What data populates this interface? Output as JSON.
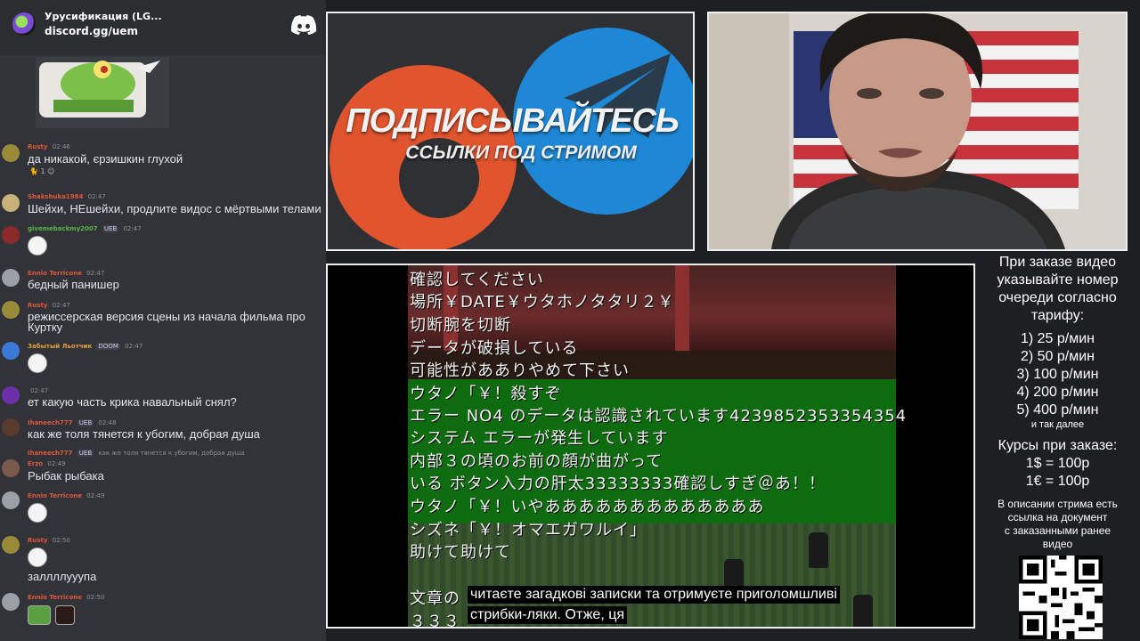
{
  "server": {
    "name": "Урусификация (LG...",
    "invite": "discord.gg/uem"
  },
  "chat": {
    "messages": [
      {
        "user": "Rusty",
        "time": "02:46",
        "text": "да никакой, єрзишкин глухой",
        "reactions": "1"
      },
      {
        "user": "Shakshuka1984",
        "time": "02:47",
        "text": "Шейхи, НЕшейхи, продлите видос с мёртвыми телами"
      },
      {
        "user": "givemebackmy2007",
        "badge": "UEB",
        "time": "02:47",
        "text": ""
      },
      {
        "user": "Ennio Terricone",
        "time": "02:47",
        "text": "бедный панишер"
      },
      {
        "user": "Rusty",
        "time": "02:47",
        "text": "режиссерская версия сцены из начала фильма про",
        "text2": "Куртку"
      },
      {
        "user": "Забытый Льотчик",
        "badge": "DOOM",
        "time": "02:47",
        "text": ""
      },
      {
        "user": "",
        "time": "02:47",
        "text": "ет какую часть крика навальный снял?"
      },
      {
        "user": "Ihaneech777",
        "badge": "UEB",
        "time": "02:48",
        "text": "как же толя тянется к убогим, добрая душа"
      },
      {
        "user": "Ihaneech777",
        "badge": "UEB",
        "time": "",
        "text": "как же толя тянется к убогим, добрая душа"
      },
      {
        "user": "Erzo",
        "time": "02:49",
        "text": "Рыбак рыбака"
      },
      {
        "user": "Ennio Terricone",
        "time": "02:49",
        "text": ""
      },
      {
        "user": "Rusty",
        "time": "02:50",
        "text": ""
      },
      {
        "user": "",
        "time": "",
        "text": "заллллууупа"
      },
      {
        "user": "Ennio Terricone",
        "time": "02:50",
        "text": ""
      }
    ]
  },
  "promo": {
    "headline": "ПОДПИСЫВАЙТЕСЬ",
    "subline": "ССЫЛКИ ПОД СТРИМОМ"
  },
  "game": {
    "lines": [
      "確認してください",
      "場所￥DATE￥ウタホノタタリ２￥",
      "切断腕を切断",
      "データが破損している",
      "可能性があありやめて下さい",
      "ウタノ「￥！殺すぞ",
      "エラー NO4 のデータは認識されています4239852353354354",
      "システム エラーが発生しています",
      "内部３の頃のお前の顔が曲がって",
      "いる ボタン入力の肝太33333333確認しすぎ＠あ！！",
      "ウタノ「￥！いやあああああああああああああ",
      "シズネ「￥！オマエガワルイ」",
      "助けて助けて",
      "文章の",
      "３３３"
    ],
    "caption_line1": "читаєте загадкові записки та отримуєте приголомшливі",
    "caption_line2": "стрибки-ляки.  Отже, ця"
  },
  "pricing": {
    "intro": [
      "При заказе видео",
      "указывайте номер",
      "очереди согласно",
      "тарифу:"
    ],
    "rates": [
      "1) 25 р/мин",
      "2) 50 р/мин",
      "3) 100 р/мин",
      "4) 200 р/мин",
      "5) 400 р/мин"
    ],
    "more": "и так далее",
    "courses_title": "Курсы при заказе:",
    "courses": [
      "1$ = 100р",
      "1€ = 100р"
    ],
    "note": [
      "В описании стрима есть",
      "ссылка на документ",
      "с заказанными ранее",
      "видео"
    ]
  },
  "colors": {
    "discord_bg": "#313338",
    "boosty": "#e0542e",
    "telegram": "#1e88d6",
    "game_green": "#0f6b0f"
  }
}
